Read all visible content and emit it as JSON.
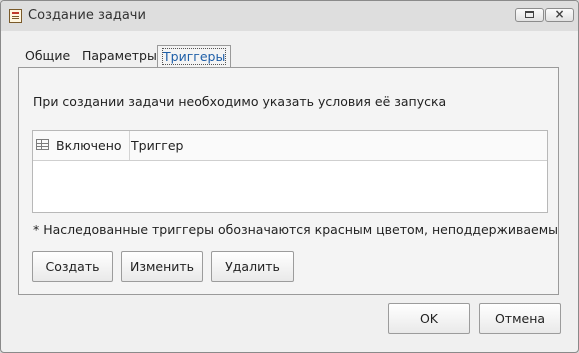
{
  "window": {
    "title": "Создание задачи"
  },
  "tabs": [
    {
      "label": "Общие"
    },
    {
      "label": "Параметры"
    },
    {
      "label": "Триггеры"
    }
  ],
  "triggers_panel": {
    "instruction": "При создании задачи необходимо указать условия её запуска",
    "table": {
      "columns": [
        "Включено",
        "Триггер"
      ],
      "rows": []
    },
    "note": "* Наследованные триггеры обозначаются красным цветом, неподдерживаемые данным",
    "buttons": {
      "create": "Создать",
      "edit": "Изменить",
      "delete": "Удалить"
    }
  },
  "dialog_buttons": {
    "ok": "OK",
    "cancel": "Отмена"
  },
  "colors": {
    "active_tab_text": "#1f5fa8"
  },
  "icons": [
    "app-task-icon",
    "maximize-icon",
    "close-icon",
    "grid-columns-icon"
  ]
}
